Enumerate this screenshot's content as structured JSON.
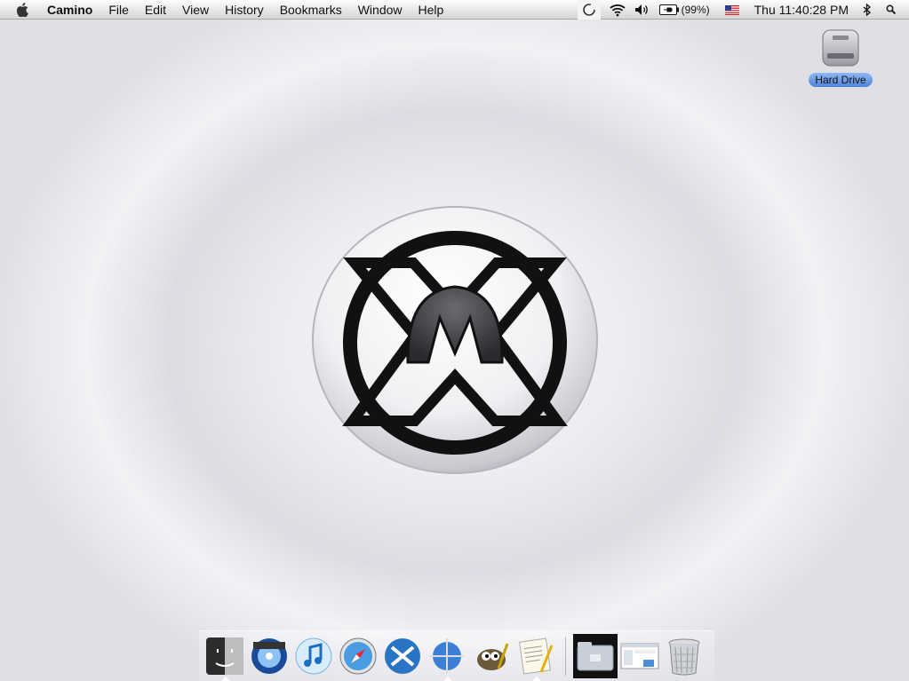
{
  "menubar": {
    "app_name": "Camino",
    "menus": [
      "File",
      "Edit",
      "View",
      "History",
      "Bookmarks",
      "Window",
      "Help"
    ],
    "battery_percent": "(99%)",
    "clock": "Thu 11:40:28 PM"
  },
  "desktop": {
    "hard_drive_label": "Hard Drive"
  },
  "dock": {
    "items": [
      "finder",
      "dvd-player",
      "itunes",
      "safari",
      "x-app",
      "camino",
      "gimp",
      "textedit",
      "hard-drive-folder",
      "window-preview",
      "trash"
    ]
  },
  "colors": {
    "selection": "#5b8fe0",
    "menubar": "#e6e6e6"
  }
}
